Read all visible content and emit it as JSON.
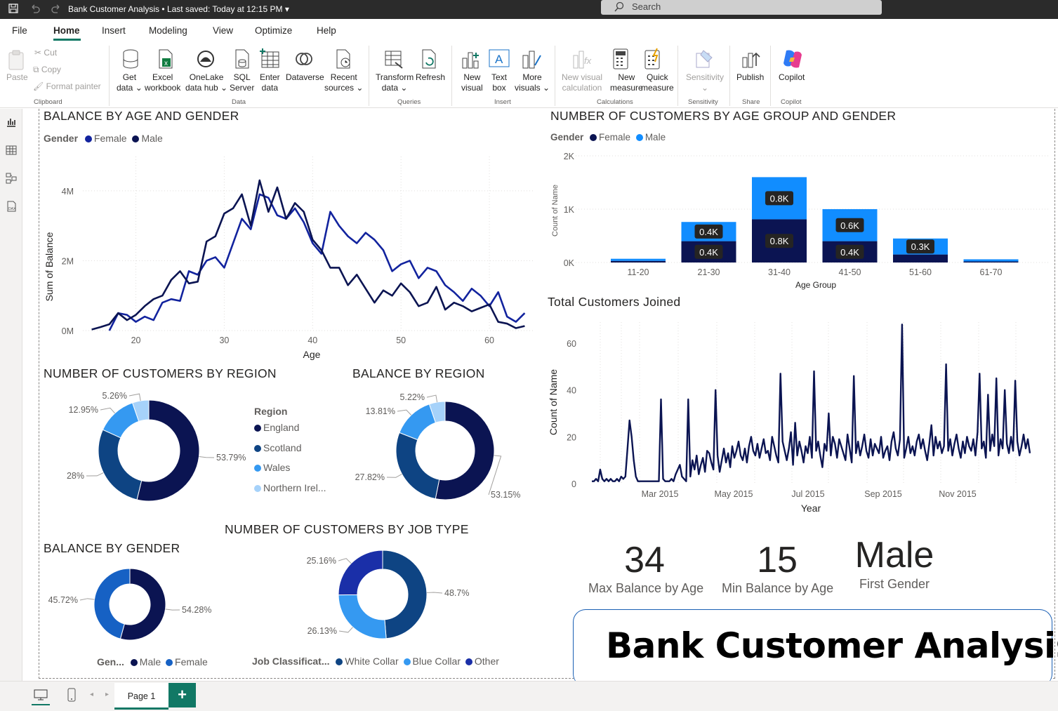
{
  "app": {
    "title": "Bank Customer Analysis",
    "saved": "• Last saved: Today at 12:15 PM",
    "search_placeholder": "Search"
  },
  "menu": [
    "File",
    "Home",
    "Insert",
    "Modeling",
    "View",
    "Optimize",
    "Help"
  ],
  "ribbon": {
    "clipboard": {
      "paste": "Paste",
      "cut": "Cut",
      "copy": "Copy",
      "format": "Format painter",
      "label": "Clipboard"
    },
    "data": {
      "get": "Get\ndata ⌄",
      "excel": "Excel\nworkbook",
      "onelake": "OneLake\ndata hub ⌄",
      "sql": "SQL\nServer",
      "enter": "Enter\ndata",
      "dataverse": "Dataverse",
      "recent": "Recent\nsources ⌄",
      "label": "Data"
    },
    "queries": {
      "transform": "Transform\ndata ⌄",
      "refresh": "Refresh",
      "label": "Queries"
    },
    "insert": {
      "newvisual": "New\nvisual",
      "textbox": "Text\nbox",
      "more": "More\nvisuals ⌄",
      "label": "Insert"
    },
    "calc": {
      "nvc": "New visual\ncalculation",
      "nm": "New\nmeasure",
      "qm": "Quick\nmeasure",
      "label": "Calculations"
    },
    "sens": {
      "s": "Sensitivity\n⌄",
      "label": "Sensitivity"
    },
    "share": {
      "publish": "Publish",
      "label": "Share"
    },
    "copilot": {
      "c": "Copilot",
      "label": "Copilot"
    }
  },
  "colors": {
    "female": "#12239e",
    "male": "#0b1452",
    "male_bar": "#118dff",
    "england": "#0b1452",
    "scotland": "#0e4483",
    "wales": "#3599f1",
    "ni": "#a6d2fa",
    "fem_donut": "#1661c4",
    "other": "#1a2fa8"
  },
  "line_chart": {
    "title": "BALANCE BY AGE AND GENDER",
    "legend_title": "Gender",
    "legend": [
      "Female",
      "Male"
    ],
    "xlabel": "Age",
    "ylabel": "Sum of Balance",
    "yticks": [
      "4M",
      "2M",
      "0M"
    ],
    "xticks": [
      "20",
      "30",
      "40",
      "50",
      "60"
    ]
  },
  "bar_chart": {
    "title": "NUMBER OF CUSTOMERS BY AGE GROUP AND GENDER",
    "legend_title": "Gender",
    "legend": [
      "Female",
      "Male"
    ],
    "xlabel": "Age Group",
    "ylabel": "Count of Name",
    "yticks": [
      "2K",
      "1K",
      "0K"
    ]
  },
  "region_count": {
    "title": "NUMBER OF CUSTOMERS BY REGION",
    "legend_title": "Region",
    "legend": [
      "England",
      "Scotland",
      "Wales",
      "Northern Irel..."
    ]
  },
  "region_balance": {
    "title": "BALANCE BY REGION"
  },
  "gender_balance": {
    "title": "BALANCE BY GENDER",
    "legend_title": "Gen...",
    "legend": [
      "Male",
      "Female"
    ]
  },
  "job": {
    "title": "NUMBER OF CUSTOMERS BY JOB TYPE",
    "legend_title": "Job Classificat...",
    "legend": [
      "White Collar",
      "Blue Collar",
      "Other"
    ]
  },
  "joined": {
    "title": "Total Customers Joined",
    "xlabel": "Year",
    "ylabel": "Count of Name",
    "xticks": [
      "Mar 2015",
      "May 2015",
      "Jul 2015",
      "Sep 2015",
      "Nov 2015"
    ],
    "yticks": [
      "60",
      "40",
      "20",
      "0"
    ]
  },
  "kpis": [
    {
      "value": "34",
      "label": "Max Balance by Age"
    },
    {
      "value": "15",
      "label": "Min Balance by Age"
    },
    {
      "value": "Male",
      "label": "First Gender"
    }
  ],
  "banner": "Bank Customer Analysis",
  "footer": {
    "page": "Page 1",
    "add": "+"
  },
  "chart_data": [
    {
      "type": "line",
      "title": "BALANCE BY AGE AND GENDER",
      "xlabel": "Age",
      "ylabel": "Sum of Balance",
      "ylim": [
        0,
        4500000
      ],
      "series": [
        {
          "name": "Female",
          "x": [
            17,
            18,
            19,
            20,
            21,
            22,
            23,
            24,
            25,
            26,
            27,
            28,
            29,
            30,
            31,
            32,
            33,
            34,
            35,
            36,
            37,
            38,
            39,
            40,
            41,
            42,
            43,
            44,
            45,
            46,
            47,
            48,
            49,
            50,
            51,
            52,
            53,
            54,
            55,
            56,
            57,
            58,
            59,
            60,
            61,
            62,
            63,
            64
          ],
          "values": [
            0,
            500000,
            450000,
            250000,
            400000,
            300000,
            800000,
            900000,
            850000,
            1700000,
            1600000,
            2000000,
            2100000,
            1800000,
            2500000,
            3200000,
            2900000,
            3900000,
            3800000,
            3300000,
            3200000,
            3500000,
            3100000,
            2500000,
            2200000,
            3400000,
            3000000,
            2700000,
            2500000,
            2800000,
            2600000,
            2300000,
            1700000,
            1900000,
            2000000,
            1500000,
            1800000,
            1700000,
            1300000,
            1100000,
            850000,
            1200000,
            1000000,
            700000,
            1100000,
            400000,
            250000,
            500000
          ]
        },
        {
          "name": "Male",
          "x": [
            15,
            16,
            17,
            18,
            19,
            20,
            21,
            22,
            23,
            24,
            25,
            26,
            27,
            28,
            29,
            30,
            31,
            32,
            33,
            34,
            35,
            36,
            37,
            38,
            39,
            40,
            41,
            42,
            43,
            44,
            45,
            46,
            47,
            48,
            49,
            50,
            51,
            52,
            53,
            54,
            55,
            56,
            57,
            58,
            59,
            60,
            61,
            62,
            63,
            64
          ],
          "values": [
            30000,
            100000,
            180000,
            500000,
            300000,
            450000,
            700000,
            900000,
            1000000,
            1450000,
            1700000,
            1350000,
            1400000,
            2550000,
            2700000,
            3350000,
            3500000,
            3900000,
            3000000,
            4300000,
            3400000,
            4100000,
            3200000,
            3650000,
            3400000,
            2600000,
            2300000,
            1800000,
            1800000,
            1300000,
            1600000,
            1200000,
            800000,
            1150000,
            1000000,
            1350000,
            1100000,
            700000,
            800000,
            1250000,
            600000,
            800000,
            700000,
            550000,
            650000,
            750000,
            250000,
            200000,
            70000,
            130000
          ]
        }
      ]
    },
    {
      "type": "bar",
      "title": "NUMBER OF CUSTOMERS BY AGE GROUP AND GENDER",
      "categories": [
        "11-20",
        "21-30",
        "31-40",
        "41-50",
        "51-60",
        "61-70"
      ],
      "ylim": [
        0,
        2000
      ],
      "series": [
        {
          "name": "Female",
          "values": [
            30,
            400,
            810,
            400,
            150,
            20
          ],
          "labels": [
            "",
            "0.4K",
            "0.8K",
            "0.4K",
            "",
            ""
          ]
        },
        {
          "name": "Male",
          "values": [
            40,
            360,
            790,
            600,
            300,
            40
          ],
          "labels": [
            "",
            "0.4K",
            "0.8K",
            "0.6K",
            "0.3K",
            ""
          ]
        }
      ]
    },
    {
      "type": "pie",
      "title": "NUMBER OF CUSTOMERS BY REGION",
      "categories": [
        "England",
        "Scotland",
        "Wales",
        "Northern Irel..."
      ],
      "values": [
        53.79,
        28,
        12.95,
        5.26
      ],
      "labels": [
        "53.79%",
        "28%",
        "12.95%",
        "5.26%"
      ]
    },
    {
      "type": "pie",
      "title": "BALANCE BY REGION",
      "categories": [
        "England",
        "Scotland",
        "Wales",
        "Northern Irel..."
      ],
      "values": [
        53.15,
        27.82,
        13.81,
        5.22
      ],
      "labels": [
        "53.15%",
        "27.82%",
        "13.81%",
        "5.22%"
      ]
    },
    {
      "type": "pie",
      "title": "BALANCE BY GENDER",
      "categories": [
        "Male",
        "Female"
      ],
      "values": [
        54.28,
        45.72
      ],
      "labels": [
        "54.28%",
        "45.72%"
      ]
    },
    {
      "type": "pie",
      "title": "NUMBER OF CUSTOMERS BY JOB TYPE",
      "categories": [
        "White Collar",
        "Blue Collar",
        "Other"
      ],
      "values": [
        48.7,
        26.13,
        25.16
      ],
      "labels": [
        "48.7%",
        "26.13%",
        "25.16%"
      ]
    },
    {
      "type": "line",
      "title": "Total Customers Joined",
      "xlabel": "Year",
      "ylabel": "Count of Name",
      "ylim": [
        0,
        70
      ],
      "series": [
        {
          "name": "",
          "values": [
            1,
            1,
            2,
            1,
            6,
            2,
            1,
            2,
            1,
            2,
            1,
            1,
            2,
            1,
            3,
            2,
            3,
            15,
            27,
            20,
            10,
            3,
            1,
            1,
            1,
            1,
            1,
            1,
            1,
            1,
            1,
            1,
            1,
            36,
            2,
            1,
            1,
            1,
            2,
            1,
            4,
            6,
            8,
            3,
            2,
            1,
            36,
            3,
            10,
            6,
            12,
            4,
            8,
            11,
            5,
            14,
            13,
            9,
            6,
            40,
            12,
            5,
            10,
            15,
            9,
            13,
            7,
            16,
            11,
            14,
            18,
            12,
            10,
            15,
            9,
            16,
            20,
            14,
            12,
            17,
            11,
            15,
            19,
            13,
            14,
            10,
            20,
            16,
            12,
            9,
            47,
            18,
            14,
            10,
            15,
            22,
            8,
            26,
            12,
            18,
            14,
            9,
            16,
            13,
            20,
            11,
            48,
            14,
            18,
            12,
            7,
            17,
            14,
            30,
            12,
            20,
            17,
            11,
            19,
            16,
            13,
            10,
            21,
            15,
            9,
            46,
            13,
            18,
            12,
            16,
            21,
            14,
            11,
            19,
            12,
            17,
            15,
            13,
            20,
            11,
            14,
            16,
            10,
            18,
            22,
            15,
            12,
            19,
            68,
            11,
            15,
            20,
            13,
            16,
            12,
            18,
            21,
            15,
            19,
            14,
            10,
            17,
            25,
            12,
            20,
            15,
            18,
            13,
            16,
            51,
            14,
            19,
            12,
            17,
            21,
            15,
            11,
            18,
            13,
            20,
            16,
            14,
            19,
            12,
            22,
            47,
            15,
            18,
            11,
            38,
            14,
            21,
            16,
            45,
            12,
            19,
            15,
            40,
            17,
            13,
            20,
            14,
            44,
            18,
            12,
            16,
            21,
            15,
            19,
            13
          ]
        }
      ]
    }
  ]
}
